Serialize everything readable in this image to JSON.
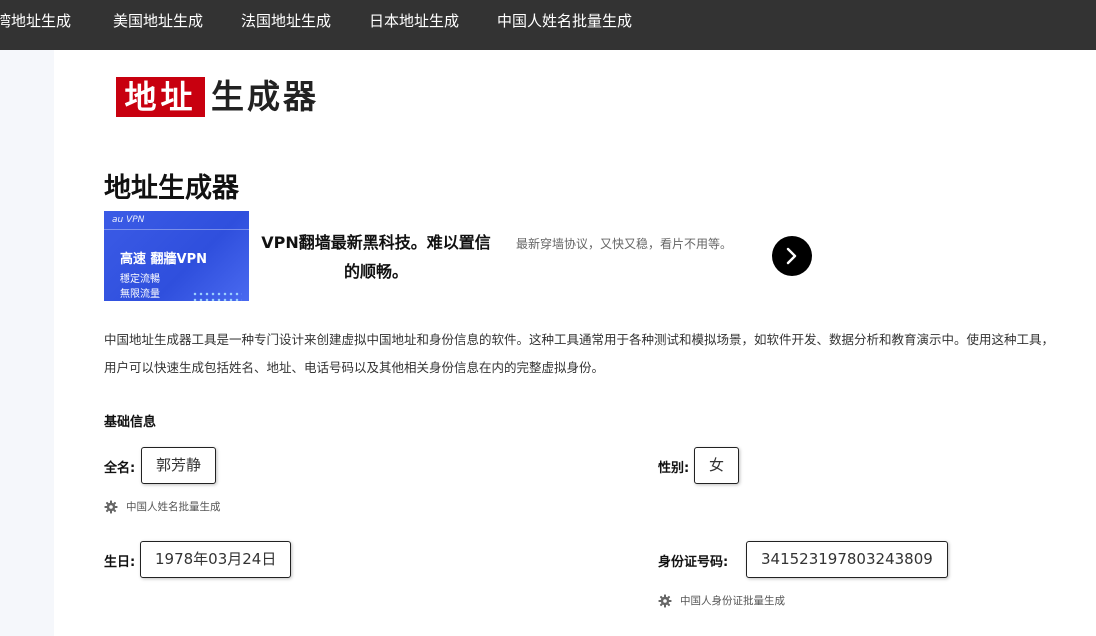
{
  "nav": {
    "items": [
      {
        "label": "湾地址生成"
      },
      {
        "label": "美国地址生成"
      },
      {
        "label": "法国地址生成"
      },
      {
        "label": "日本地址生成"
      },
      {
        "label": "中国人姓名批量生成"
      }
    ]
  },
  "logo": {
    "red_text": "地址",
    "dark_text": "生成器"
  },
  "page_title": "地址生成器",
  "ad": {
    "image": {
      "brand": "au VPN",
      "headline": "高速  翻牆VPN",
      "line1": "穩定流暢",
      "line2": "無限流量",
      "color": "#3b5be6"
    },
    "title": "VPN翻墙最新黑科技。难以置信的顺畅。",
    "description": "最新穿墙协议，又快又稳，看片不用等。",
    "arrow_icon": "chevron-right-icon"
  },
  "intro": "中国地址生成器工具是一种专门设计来创建虚拟中国地址和身份信息的软件。这种工具通常用于各种测试和模拟场景，如软件开发、数据分析和教育演示中。使用这种工具，用户可以快速生成包括姓名、地址、电话号码以及其他相关身份信息在内的完整虚拟身份。",
  "basic_info": {
    "section_title": "基础信息",
    "name": {
      "label": "全名:",
      "value": "郭芳静",
      "link": "中国人姓名批量生成"
    },
    "gender": {
      "label": "性别:",
      "value": "女"
    },
    "birthday": {
      "label": "生日:",
      "value": "1978年03月24日"
    },
    "id_number": {
      "label": "身份证号码:",
      "value": "341523197803243809",
      "link": "中国人身份证批量生成"
    }
  },
  "colors": {
    "nav_bg": "#333333",
    "logo_red": "#c8000f",
    "ad_blue": "#3b5be6"
  }
}
